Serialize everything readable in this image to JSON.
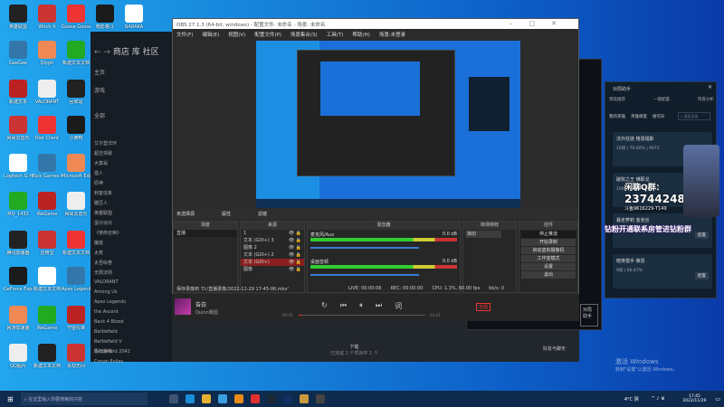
{
  "desktop": {
    "icons": [
      "英雄联盟",
      "Witch It",
      "Goose Goose Duck",
      "暗影格斗",
      "NARAKA",
      "GeeGee",
      "Qlyph",
      "新建文本文档",
      "新建文本",
      "VALORANT",
      "回收站",
      "网易云音乐",
      "Riot Client",
      "小黄鸭",
      "Logitech G HUB",
      "Epic Games Launcher",
      "Microsoft Edge",
      "MQ_1432",
      "WeGame",
      "网易云音乐",
      "腾讯加速器",
      "应用宝",
      "新建文本文档",
      "GeForce Experience",
      "新建文本文档",
      "Apex Legends",
      "网游加速器",
      "WeGame",
      "守望先锋",
      "QQ图片",
      "新建文本文档",
      "永劫无间"
    ],
    "watermark_title": "激活 Windows",
    "watermark_sub": "转到\"设置\"以激活 Windows。"
  },
  "steam": {
    "nav": [
      "商店",
      "库",
      "社区"
    ],
    "home": "主页",
    "games_label": "游戏",
    "all_label": "全部",
    "games": [
      "艾尔登法环",
      "超击突破",
      "大富翁",
      "猎人",
      "原神",
      "刺客信条",
      "糖豆人",
      "英雄联盟",
      "蛋仔派对",
      "《使命召唤》",
      "魔兽",
      "太荒",
      "太吾绘卷",
      "无限法则",
      "VALORANT",
      "Among Us",
      "Apex Legends",
      "the Ascent",
      "Back 4 Blood",
      "Battlefield",
      "Battlefield V",
      "Battlefield 2042",
      "Conan Exiles"
    ],
    "add_game": "添加游戏",
    "downloads": "下载",
    "downloads_sub": "已完成 1 个项目中 1 个",
    "friends": "好友与聊天"
  },
  "obs": {
    "title": "OBS 27.1.3 (64-bit, windows) - 配置文件: 未命名 - 场景: 未命名",
    "menu": [
      "文件(F)",
      "编辑(E)",
      "视图(V)",
      "配置文件(P)",
      "场景集合(S)",
      "工具(T)",
      "帮助(H)",
      "场景:未登录"
    ],
    "source_bar": {
      "label": "未选择源",
      "props": "属性",
      "filters": "滤镜"
    },
    "scenes": {
      "header": "场景",
      "items": [
        "直播"
      ]
    },
    "sources": {
      "header": "来源",
      "items": [
        "1",
        "文本 (GDI+) 3",
        "图像 2",
        "文本 (GDI+) 2",
        "文本 (GDI+)",
        "图像"
      ],
      "selected": 4
    },
    "mixer": {
      "header": "混音器",
      "channels": [
        {
          "name": "麦克风/Aux",
          "db": "0.0 dB"
        },
        {
          "name": "桌面音频",
          "db": "0.0 dB"
        }
      ]
    },
    "transitions": {
      "header": "转场特效",
      "value": "渐切"
    },
    "controls": {
      "header": "控件",
      "buttons": [
        "停止推流",
        "开始录制",
        "启动虚拟摄像机",
        "工作室模式",
        "设置",
        "退出"
      ]
    },
    "status": {
      "saved": "保存录像到 'D:/直播录像/2022-11-29 17-45-06.mkv'",
      "live": "LIVE: 00:00:06",
      "rec": "REC: 00:00:00",
      "cpu": "CPU: 1.3%, 60.00 fps",
      "kbps": "kb/s: 0"
    }
  },
  "music": {
    "song": "告白",
    "artist": "Quinn黎因",
    "elapsed": "00:05",
    "total": "03:43",
    "progress": 0.03,
    "badge": "无损"
  },
  "helper": {
    "title": "对局助手",
    "tabs": [
      "预选推荐",
      "一键配置",
      "阵容分析"
    ],
    "subtabs": [
      "我的英雄",
      "英雄梯度",
      "搜可乐"
    ],
    "search_placeholder": "搜索英雄",
    "cards": [
      {
        "name": "法外狂徒 格雷福斯",
        "stats": "10场 | 70.00% | 9071",
        "btn": "配置"
      },
      {
        "name": "破败之王 佛耶戈",
        "stats": "10场 | 60.00% | 9842",
        "btn": "配置"
      },
      {
        "name": "暴走萝莉 金克丝",
        "stats": "9场 | 44.44% | 10606",
        "btn": "配置"
      },
      {
        "name": "暗夜猎手 薇恩",
        "stats": "9场 | 66.67%",
        "btn": "配置"
      }
    ],
    "side_label": "对局助手"
  },
  "overlay": {
    "qq_label": "闲聊Q群：",
    "qq_number": "237442484",
    "douyu": "斗鱼9616229-T149",
    "banner": "钻粉开通联系房管进钻粉群"
  },
  "taskbar": {
    "search_placeholder": "在这里输入你要搜索的内容",
    "weather": "4°C 阴",
    "time": "17:45",
    "date": "2022/11/29"
  }
}
